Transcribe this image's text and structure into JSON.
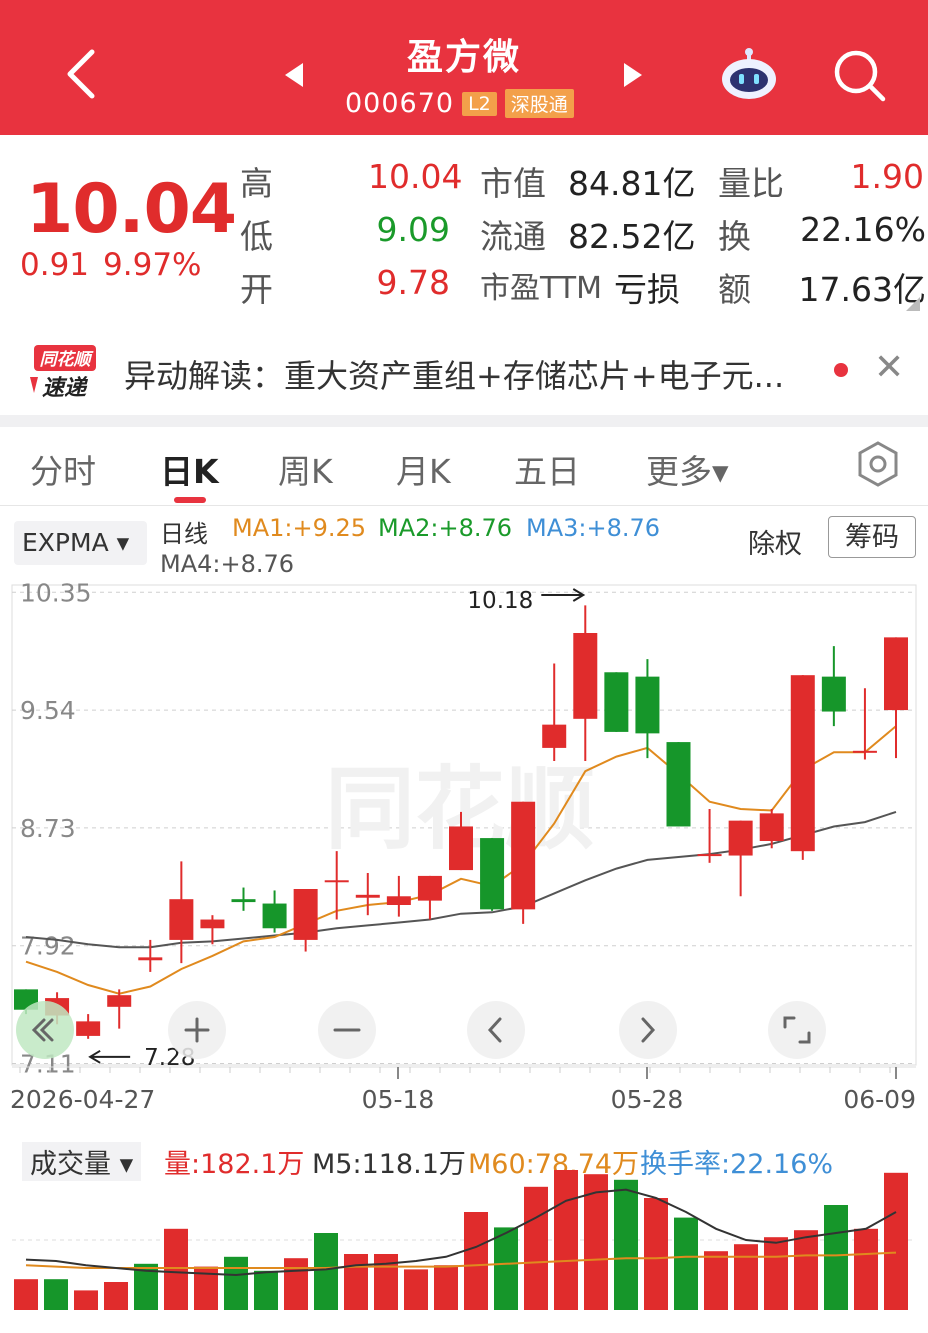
{
  "header": {
    "title": "盈方微",
    "code": "000670",
    "tag_l2": "L2",
    "tag_connect": "深股通"
  },
  "quote": {
    "price": "10.04",
    "change": "0.91",
    "change_pct": "9.97%",
    "high_label": "高",
    "high": "10.04",
    "low_label": "低",
    "low": "9.09",
    "open_label": "开",
    "open": "9.78",
    "mcap_label": "市值",
    "mcap": "84.81亿",
    "float_label": "流通",
    "float": "82.52亿",
    "pe_label": "市盈TTM",
    "pe": "亏损",
    "vr_label": "量比",
    "vr": "1.90",
    "turn_label": "换",
    "turn": "22.16%",
    "amt_label": "额",
    "amt": "17.63亿"
  },
  "news": {
    "logo_top": "同花顺",
    "logo_bottom": "速递",
    "text": "异动解读：重大资产重组+存储芯片+电子元..."
  },
  "tabs": [
    "分时",
    "日K",
    "周K",
    "月K",
    "五日",
    "更多▾"
  ],
  "active_tab": 1,
  "indicator": {
    "name": "EXPMA ▾",
    "period": "日线",
    "ma1": "MA1:+9.25",
    "ma2": "MA2:+8.76",
    "ma3": "MA3:+8.76",
    "ma4": "MA4:+8.76",
    "ex_rights": "除权",
    "chips": "筹码"
  },
  "colors": {
    "up": "#e02c2c",
    "down": "#16962a",
    "ma1": "#e08a1e",
    "ma2": "#1a9a2a",
    "ma3": "#3f8fd6",
    "ma4": "#555555",
    "header": "#e8333f"
  },
  "chart_data": [
    {
      "type": "candlestick",
      "title": "日线",
      "y_ticks": [
        "10.35",
        "9.54",
        "8.73",
        "7.92",
        "7.11"
      ],
      "ylim": [
        7.1,
        10.4
      ],
      "x_tick_labels": [
        "2026-04-27",
        "05-18",
        "05-28",
        "06-09"
      ],
      "annotations": {
        "high": "10.18",
        "low": "7.28"
      },
      "candles": [
        {
          "o": 7.62,
          "c": 7.48,
          "h": 7.62,
          "l": 7.45
        },
        {
          "o": 7.44,
          "c": 7.56,
          "h": 7.6,
          "l": 7.38
        },
        {
          "o": 7.3,
          "c": 7.4,
          "h": 7.45,
          "l": 7.28
        },
        {
          "o": 7.5,
          "c": 7.58,
          "h": 7.62,
          "l": 7.35
        },
        {
          "o": 7.82,
          "c": 7.84,
          "h": 7.96,
          "l": 7.74
        },
        {
          "o": 7.96,
          "c": 8.24,
          "h": 8.5,
          "l": 7.8
        },
        {
          "o": 8.04,
          "c": 8.1,
          "h": 8.13,
          "l": 7.93
        },
        {
          "o": 8.24,
          "c": 8.22,
          "h": 8.32,
          "l": 8.16
        },
        {
          "o": 8.21,
          "c": 8.04,
          "h": 8.3,
          "l": 8.01
        },
        {
          "o": 7.96,
          "c": 8.31,
          "h": 8.31,
          "l": 7.88
        },
        {
          "o": 8.37,
          "c": 8.37,
          "h": 8.57,
          "l": 8.1
        },
        {
          "o": 8.25,
          "c": 8.27,
          "h": 8.42,
          "l": 8.13
        },
        {
          "o": 8.2,
          "c": 8.26,
          "h": 8.4,
          "l": 8.12
        },
        {
          "o": 8.23,
          "c": 8.4,
          "h": 8.4,
          "l": 8.1
        },
        {
          "o": 8.44,
          "c": 8.74,
          "h": 8.84,
          "l": 8.44
        },
        {
          "o": 8.66,
          "c": 8.17,
          "h": 8.66,
          "l": 8.16
        },
        {
          "o": 8.17,
          "c": 8.91,
          "h": 8.91,
          "l": 8.07
        },
        {
          "o": 9.28,
          "c": 9.44,
          "h": 9.86,
          "l": 9.19
        },
        {
          "o": 9.48,
          "c": 10.07,
          "h": 10.26,
          "l": 9.19
        },
        {
          "o": 9.8,
          "c": 9.39,
          "h": 9.8,
          "l": 9.39
        },
        {
          "o": 9.77,
          "c": 9.38,
          "h": 9.89,
          "l": 9.21
        },
        {
          "o": 9.32,
          "c": 8.74,
          "h": 9.32,
          "l": 8.74
        },
        {
          "o": 8.54,
          "c": 8.55,
          "h": 8.86,
          "l": 8.49
        },
        {
          "o": 8.54,
          "c": 8.78,
          "h": 8.78,
          "l": 8.26
        },
        {
          "o": 8.64,
          "c": 8.83,
          "h": 8.86,
          "l": 8.59
        },
        {
          "o": 8.57,
          "c": 9.78,
          "h": 9.78,
          "l": 8.51
        },
        {
          "o": 9.77,
          "c": 9.53,
          "h": 9.98,
          "l": 9.43
        },
        {
          "o": 9.26,
          "c": 9.26,
          "h": 9.69,
          "l": 9.2
        },
        {
          "o": 9.54,
          "c": 10.04,
          "h": 10.04,
          "l": 9.21
        }
      ],
      "series": [
        {
          "name": "MA1",
          "values": [
            7.81,
            7.74,
            7.65,
            7.59,
            7.64,
            7.76,
            7.85,
            7.95,
            7.98,
            8.07,
            8.16,
            8.2,
            8.22,
            8.27,
            8.38,
            8.33,
            8.48,
            8.76,
            9.12,
            9.22,
            9.28,
            9.1,
            8.91,
            8.86,
            8.85,
            9.13,
            9.25,
            9.25,
            9.43
          ]
        },
        {
          "name": "MA4",
          "values": [
            7.98,
            7.96,
            7.93,
            7.91,
            7.91,
            7.94,
            7.95,
            7.97,
            7.99,
            8.01,
            8.04,
            8.06,
            8.08,
            8.1,
            8.14,
            8.15,
            8.19,
            8.28,
            8.37,
            8.45,
            8.51,
            8.53,
            8.55,
            8.58,
            8.62,
            8.68,
            8.74,
            8.77,
            8.84
          ]
        }
      ]
    },
    {
      "type": "bar",
      "title": "成交量",
      "vol_label": "量:182.1万",
      "m5_label": "M5:118.1万",
      "m60_label": "M60:78.74万",
      "turnover_label": "换手率:22.16%",
      "values_pct": [
        22,
        22,
        14,
        20,
        33,
        58,
        31,
        38,
        28,
        37,
        55,
        40,
        40,
        29,
        32,
        70,
        59,
        88,
        100,
        97,
        93,
        80,
        66,
        42,
        47,
        52,
        57,
        75,
        58,
        98
      ],
      "directions": [
        "up",
        "down",
        "up",
        "up",
        "down",
        "up",
        "up",
        "down",
        "down",
        "up",
        "down",
        "up",
        "up",
        "up",
        "up",
        "up",
        "down",
        "up",
        "up",
        "up",
        "down",
        "up",
        "down",
        "up",
        "up",
        "up",
        "up",
        "down",
        "up",
        "up"
      ],
      "m5_pct": [
        36,
        35,
        32,
        30,
        28,
        27,
        26,
        25,
        27,
        28,
        29,
        32,
        33,
        35,
        38,
        45,
        55,
        66,
        78,
        84,
        86,
        80,
        70,
        58,
        50,
        48,
        52,
        55,
        58,
        70
      ],
      "m60_pct": [
        32,
        31,
        30,
        30,
        30,
        30,
        30,
        30,
        30,
        30,
        30,
        31,
        31,
        31,
        31,
        32,
        33,
        34,
        35,
        36,
        37,
        37,
        38,
        38,
        38,
        38,
        39,
        39,
        40,
        41
      ]
    }
  ]
}
